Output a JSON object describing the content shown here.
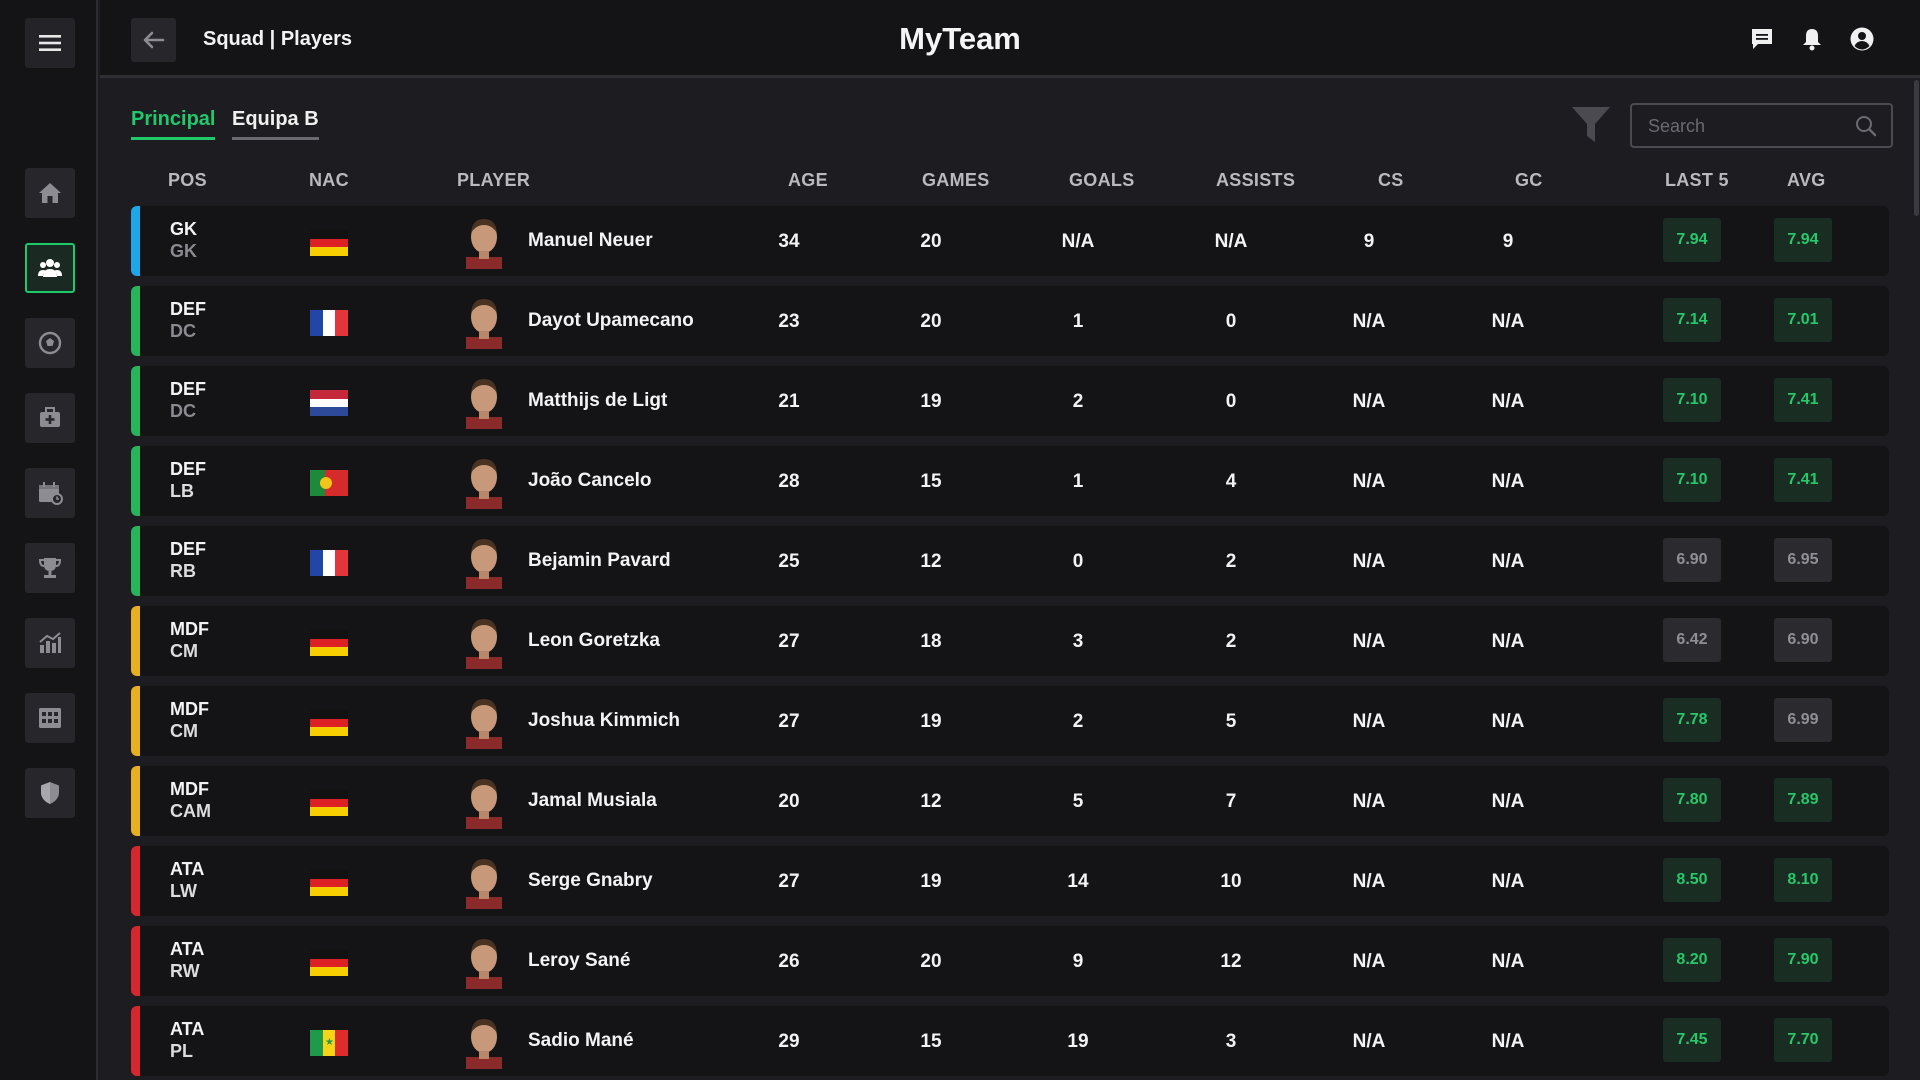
{
  "app": {
    "title": "MyTeam",
    "breadcrumb": "Squad | Players"
  },
  "tabs": [
    {
      "label": "Principal",
      "active": true
    },
    {
      "label": "Equipa B",
      "active": false
    }
  ],
  "search": {
    "placeholder": "Search"
  },
  "sidebar": {
    "items": [
      {
        "icon": "home-icon"
      },
      {
        "icon": "players-icon",
        "active": true
      },
      {
        "icon": "ball-icon"
      },
      {
        "icon": "medical-kit-icon"
      },
      {
        "icon": "calendar-icon"
      },
      {
        "icon": "trophy-icon"
      },
      {
        "icon": "stats-chart-icon"
      },
      {
        "icon": "grid-icon"
      },
      {
        "icon": "shield-icon"
      }
    ]
  },
  "columns": [
    "POS",
    "NAC",
    "PLAYER",
    "AGE",
    "GAMES",
    "GOALS",
    "ASSISTS",
    "CS",
    "GC",
    "LAST 5",
    "AVG"
  ],
  "colors": {
    "accent": "#22c86c",
    "GK": "#1ea7e8",
    "DEF": "#27b45a",
    "MDF": "#e6b021",
    "ATA": "#d2282e"
  },
  "players": [
    {
      "pos": "GK",
      "role": "GK",
      "nation": "germany",
      "name": "Manuel Neuer",
      "age": "34",
      "games": "20",
      "goals": "N/A",
      "assists": "N/A",
      "cs": "9",
      "gc": "9",
      "last5": "7.94",
      "avg": "7.94",
      "last5_good": true,
      "avg_good": true
    },
    {
      "pos": "DEF",
      "role": "DC",
      "nation": "france",
      "name": "Dayot Upamecano",
      "age": "23",
      "games": "20",
      "goals": "1",
      "assists": "0",
      "cs": "N/A",
      "gc": "N/A",
      "last5": "7.14",
      "avg": "7.01",
      "last5_good": true,
      "avg_good": true
    },
    {
      "pos": "DEF",
      "role": "DC",
      "nation": "netherlands",
      "name": "Matthijs de Ligt",
      "age": "21",
      "games": "19",
      "goals": "2",
      "assists": "0",
      "cs": "N/A",
      "gc": "N/A",
      "last5": "7.10",
      "avg": "7.41",
      "last5_good": true,
      "avg_good": true
    },
    {
      "pos": "DEF",
      "role": "LB",
      "nation": "portugal",
      "name": "João Cancelo",
      "age": "28",
      "games": "15",
      "goals": "1",
      "assists": "4",
      "cs": "N/A",
      "gc": "N/A",
      "last5": "7.10",
      "avg": "7.41",
      "last5_good": true,
      "avg_good": true
    },
    {
      "pos": "DEF",
      "role": "RB",
      "nation": "france",
      "name": "Bejamin Pavard",
      "age": "25",
      "games": "12",
      "goals": "0",
      "assists": "2",
      "cs": "N/A",
      "gc": "N/A",
      "last5": "6.90",
      "avg": "6.95",
      "last5_good": false,
      "avg_good": false
    },
    {
      "pos": "MDF",
      "role": "CM",
      "nation": "germany",
      "name": "Leon Goretzka",
      "age": "27",
      "games": "18",
      "goals": "3",
      "assists": "2",
      "cs": "N/A",
      "gc": "N/A",
      "last5": "6.42",
      "avg": "6.90",
      "last5_good": false,
      "avg_good": false
    },
    {
      "pos": "MDF",
      "role": "CM",
      "nation": "germany",
      "name": "Joshua Kimmich",
      "age": "27",
      "games": "19",
      "goals": "2",
      "assists": "5",
      "cs": "N/A",
      "gc": "N/A",
      "last5": "7.78",
      "avg": "6.99",
      "last5_good": true,
      "avg_good": false
    },
    {
      "pos": "MDF",
      "role": "CAM",
      "nation": "germany",
      "name": "Jamal Musiala",
      "age": "20",
      "games": "12",
      "goals": "5",
      "assists": "7",
      "cs": "N/A",
      "gc": "N/A",
      "last5": "7.80",
      "avg": "7.89",
      "last5_good": true,
      "avg_good": true
    },
    {
      "pos": "ATA",
      "role": "LW",
      "nation": "germany",
      "name": "Serge Gnabry",
      "age": "27",
      "games": "19",
      "goals": "14",
      "assists": "10",
      "cs": "N/A",
      "gc": "N/A",
      "last5": "8.50",
      "avg": "8.10",
      "last5_good": true,
      "avg_good": true
    },
    {
      "pos": "ATA",
      "role": "RW",
      "nation": "germany",
      "name": "Leroy Sané",
      "age": "26",
      "games": "20",
      "goals": "9",
      "assists": "12",
      "cs": "N/A",
      "gc": "N/A",
      "last5": "8.20",
      "avg": "7.90",
      "last5_good": true,
      "avg_good": true
    },
    {
      "pos": "ATA",
      "role": "PL",
      "nation": "senegal",
      "name": "Sadio Mané",
      "age": "29",
      "games": "15",
      "goals": "19",
      "assists": "3",
      "cs": "N/A",
      "gc": "N/A",
      "last5": "7.45",
      "avg": "7.70",
      "last5_good": true,
      "avg_good": true
    }
  ]
}
